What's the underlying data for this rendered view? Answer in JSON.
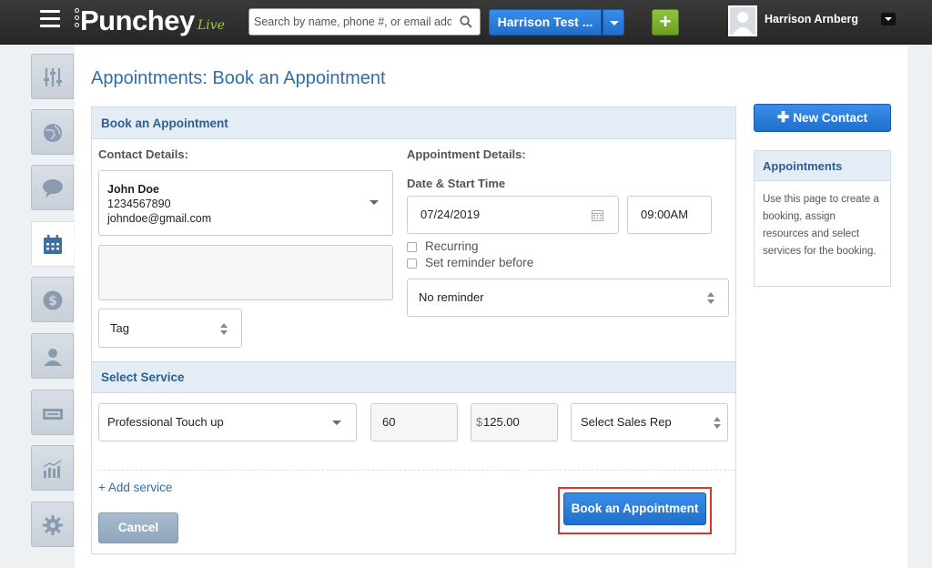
{
  "brand": {
    "name": "Punchey",
    "edition": "Live"
  },
  "search": {
    "placeholder": "Search by name, phone #, or email address"
  },
  "account": {
    "name": "Harrison Test ..."
  },
  "user": {
    "name": "Harrison Arnberg"
  },
  "sidebar": {
    "items": [
      {
        "icon": "sliders-icon"
      },
      {
        "icon": "globe-icon"
      },
      {
        "icon": "chat-bubble-icon"
      },
      {
        "icon": "calendar-icon",
        "active": true
      },
      {
        "icon": "dollar-icon"
      },
      {
        "icon": "person-icon"
      },
      {
        "icon": "register-icon"
      },
      {
        "icon": "bar-chart-icon"
      },
      {
        "icon": "gear-icon"
      }
    ]
  },
  "page": {
    "title": "Appointments: Book an Appointment"
  },
  "booking": {
    "header": "Book an Appointment",
    "contact_label": "Contact Details:",
    "contact": {
      "name": "John Doe",
      "phone": "1234567890",
      "email": "johndoe@gmail.com"
    },
    "tag_placeholder": "Tag",
    "appointment_label": "Appointment Details:",
    "datetime_label": "Date & Start Time",
    "date": "07/24/2019",
    "time": "09:00AM",
    "recurring_label": "Recurring",
    "reminder_checkbox_label": "Set reminder before",
    "reminder_value": "No reminder",
    "service_header": "Select Service",
    "service": {
      "name": "Professional Touch up",
      "duration": "60",
      "currency": "$",
      "price": "125.00",
      "sales_rep": "Select Sales Rep"
    },
    "add_service": "+ Add service",
    "cancel": "Cancel",
    "submit": "Book an Appointment"
  },
  "sidebar_right": {
    "new_contact": "New Contact",
    "help_title": "Appointments",
    "help_text": "Use this page to create a booking, assign resources and select services for the booking."
  },
  "colors": {
    "brand_blue": "#2f6ea7",
    "button_blue": "#2a7fdc",
    "green": "#7cb332",
    "highlight_red": "#d8382c"
  }
}
